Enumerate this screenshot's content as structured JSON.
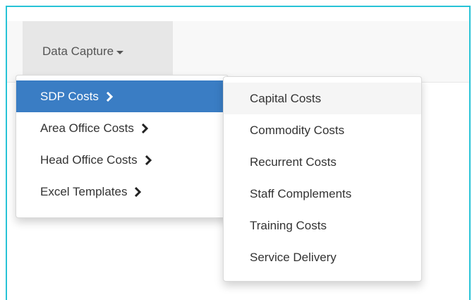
{
  "navbar": {
    "menu_label": "Data Capture"
  },
  "main_menu": {
    "items": [
      {
        "label": "SDP Costs",
        "active": true
      },
      {
        "label": "Area Office Costs",
        "active": false
      },
      {
        "label": "Head Office Costs",
        "active": false
      },
      {
        "label": "Excel Templates",
        "active": false
      }
    ]
  },
  "submenu": {
    "items": [
      {
        "label": "Capital Costs",
        "hover": true
      },
      {
        "label": "Commodity Costs"
      },
      {
        "label": "Recurrent Costs"
      },
      {
        "label": "Staff Complements"
      },
      {
        "label": "Training Costs"
      },
      {
        "label": "Service Delivery"
      }
    ]
  },
  "icons": {
    "caret": "caret-down-icon",
    "chevron": "chevron-right-icon"
  },
  "colors": {
    "active_bg": "#3a7dc4",
    "frame_border": "#27c3d6",
    "hover_bg": "#f5f5f5"
  }
}
